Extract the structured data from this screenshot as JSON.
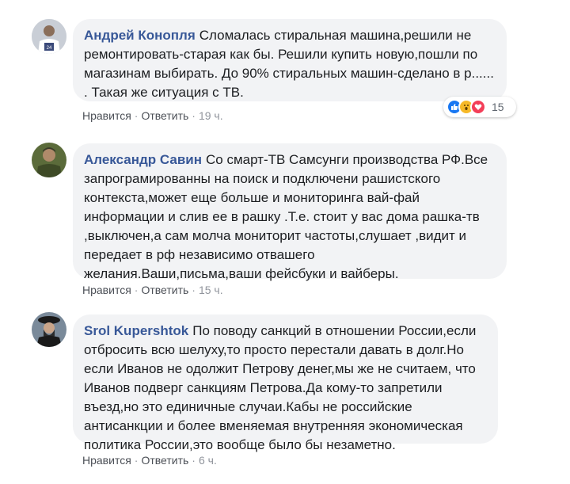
{
  "comments": [
    {
      "author": "Андрей Конопля",
      "text": "Сломалась стиральная машина,решили не ремонтировать-старая как бы. Решили купить новую,пошли по магазинам выбирать. До 90% стиральных машин-сделано в р...... . Такая же ситуация с ТВ.",
      "like_label": "Нравится",
      "reply_label": "Ответить",
      "separator": "·",
      "time": "19 ч.",
      "reactions": [
        "like-icon",
        "wow-icon",
        "love-icon"
      ],
      "reaction_count": "15"
    },
    {
      "author": "Александр Савин",
      "text": "Со смарт-ТВ Самсунги производства РФ.Все запрограмированны на поиск и подключени рашистского контекста,может еще больше и мониторинга вай-фай информации и слив ее в рашку .Т.е. стоит у вас дома рашка-тв ,выключен,а сам молча мониторит частоты,слушает ,видит и передает в рф независимо отвашего желания.Ваши,письма,ваши фейсбуки и вайберы.",
      "like_label": "Нравится",
      "reply_label": "Ответить",
      "separator": "·",
      "time": "15 ч."
    },
    {
      "author": "Srol Kupershtok",
      "text": "По поводу санкций в отношении России,если отбросить всю шелуху,то просто перестали давать в долг.Но если Иванов не одолжит Петрову денег,мы же не считаем, что Иванов подверг санкциям Петрова.Да кому-то запретили въезд,но это единичные случаи.Кабы не российские антисанкции и более вменяемая внутренняя экономическая политика России,это вообще было бы незаметно.",
      "like_label": "Нравится",
      "reply_label": "Ответить",
      "separator": "·",
      "time": "6 ч."
    }
  ],
  "colors": {
    "author": "#385898",
    "bubble": "#f2f3f5",
    "like": "#1877f2",
    "wow": "#f7b928",
    "love": "#f33e58"
  }
}
